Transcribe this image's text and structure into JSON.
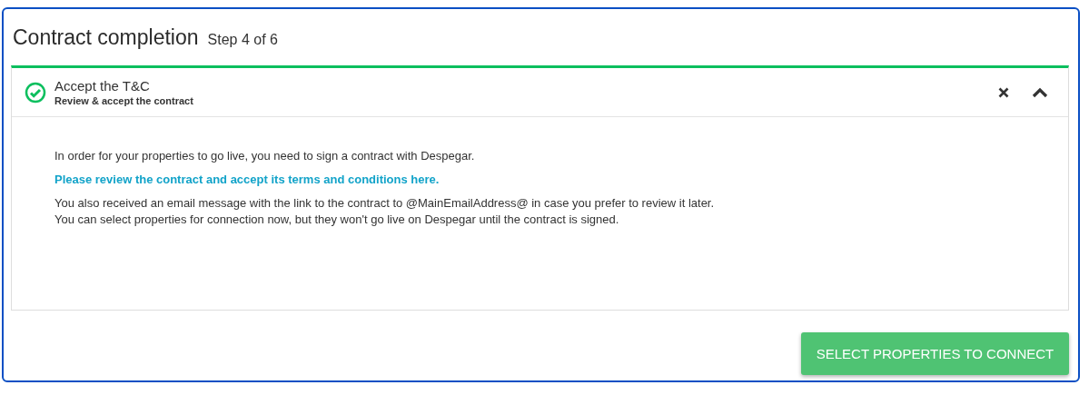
{
  "title": "Contract completion",
  "step": "Step 4 of 6",
  "step_panel": {
    "title": "Accept the T&C",
    "subtitle": "Review & accept the contract",
    "completed": true,
    "expanded": true,
    "paragraphs": [
      {
        "kind": "text",
        "text": "In order for your properties to go live, you need to sign a contract with Despegar."
      },
      {
        "kind": "link",
        "text": "Please review the contract and accept its terms and conditions here."
      },
      {
        "kind": "text",
        "text": "You also received an email message with the link to the contract to @MainEmailAddress@ in case you prefer to review it later."
      },
      {
        "kind": "text",
        "text": "You can select properties for connection now, but they won't go live on Despegar until the contract is signed."
      }
    ]
  },
  "primary_button": "SELECT PROPERTIES TO CONNECT"
}
